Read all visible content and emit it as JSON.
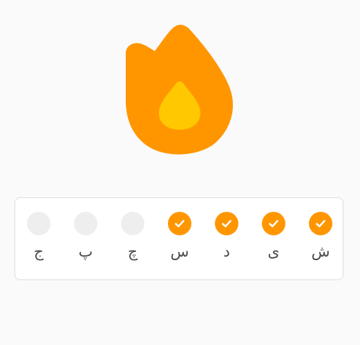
{
  "streak": {
    "icon": "flame-icon",
    "colors": {
      "flame_outer": "#ff9600",
      "flame_inner": "#ffc800"
    }
  },
  "week": {
    "colors": {
      "done": "#ff9600",
      "pending": "#eeeeee",
      "label": "#4b4b4b"
    },
    "days": [
      {
        "label": "ج",
        "done": false
      },
      {
        "label": "پ",
        "done": false
      },
      {
        "label": "چ",
        "done": false
      },
      {
        "label": "س",
        "done": true
      },
      {
        "label": "د",
        "done": true
      },
      {
        "label": "ی",
        "done": true
      },
      {
        "label": "ش",
        "done": true
      }
    ]
  }
}
